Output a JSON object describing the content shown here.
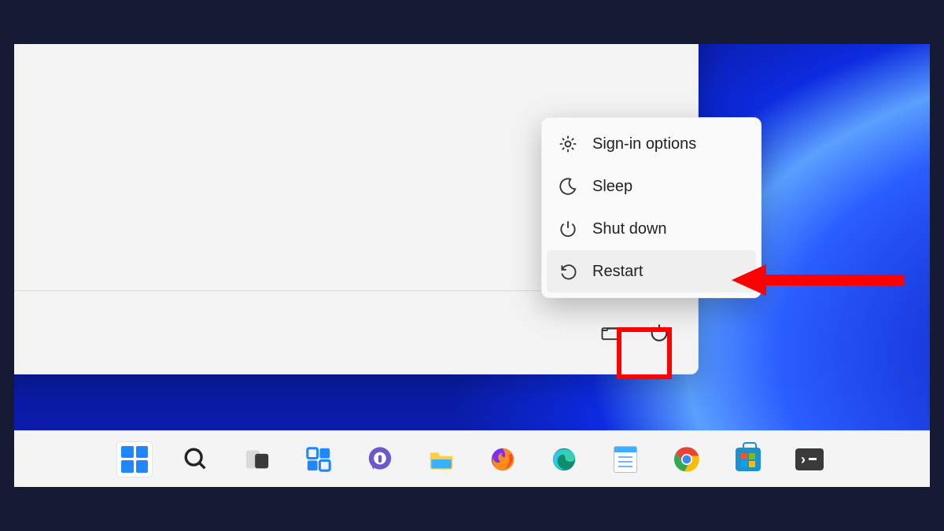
{
  "power_menu": {
    "items": [
      {
        "icon": "gear-icon",
        "label": "Sign-in options"
      },
      {
        "icon": "moon-icon",
        "label": "Sleep"
      },
      {
        "icon": "power-icon",
        "label": "Shut down"
      },
      {
        "icon": "restart-icon",
        "label": "Restart",
        "hovered": true
      }
    ]
  },
  "taskbar": {
    "items": [
      {
        "name": "start-button",
        "icon": "windows-icon",
        "active": true
      },
      {
        "name": "search-button",
        "icon": "search-icon"
      },
      {
        "name": "task-view-button",
        "icon": "task-view-icon"
      },
      {
        "name": "widgets-button",
        "icon": "widgets-icon"
      },
      {
        "name": "teams-chat-button",
        "icon": "chat-icon"
      },
      {
        "name": "file-explorer-button",
        "icon": "folder-icon"
      },
      {
        "name": "firefox-button",
        "icon": "firefox-icon"
      },
      {
        "name": "edge-button",
        "icon": "edge-icon"
      },
      {
        "name": "notepad-button",
        "icon": "notepad-icon"
      },
      {
        "name": "chrome-button",
        "icon": "chrome-icon"
      },
      {
        "name": "ms-store-button",
        "icon": "store-icon"
      },
      {
        "name": "terminal-button",
        "icon": "terminal-icon"
      }
    ]
  },
  "annotations": {
    "highlight_color": "#ff0000",
    "arrow_target": "Restart"
  }
}
